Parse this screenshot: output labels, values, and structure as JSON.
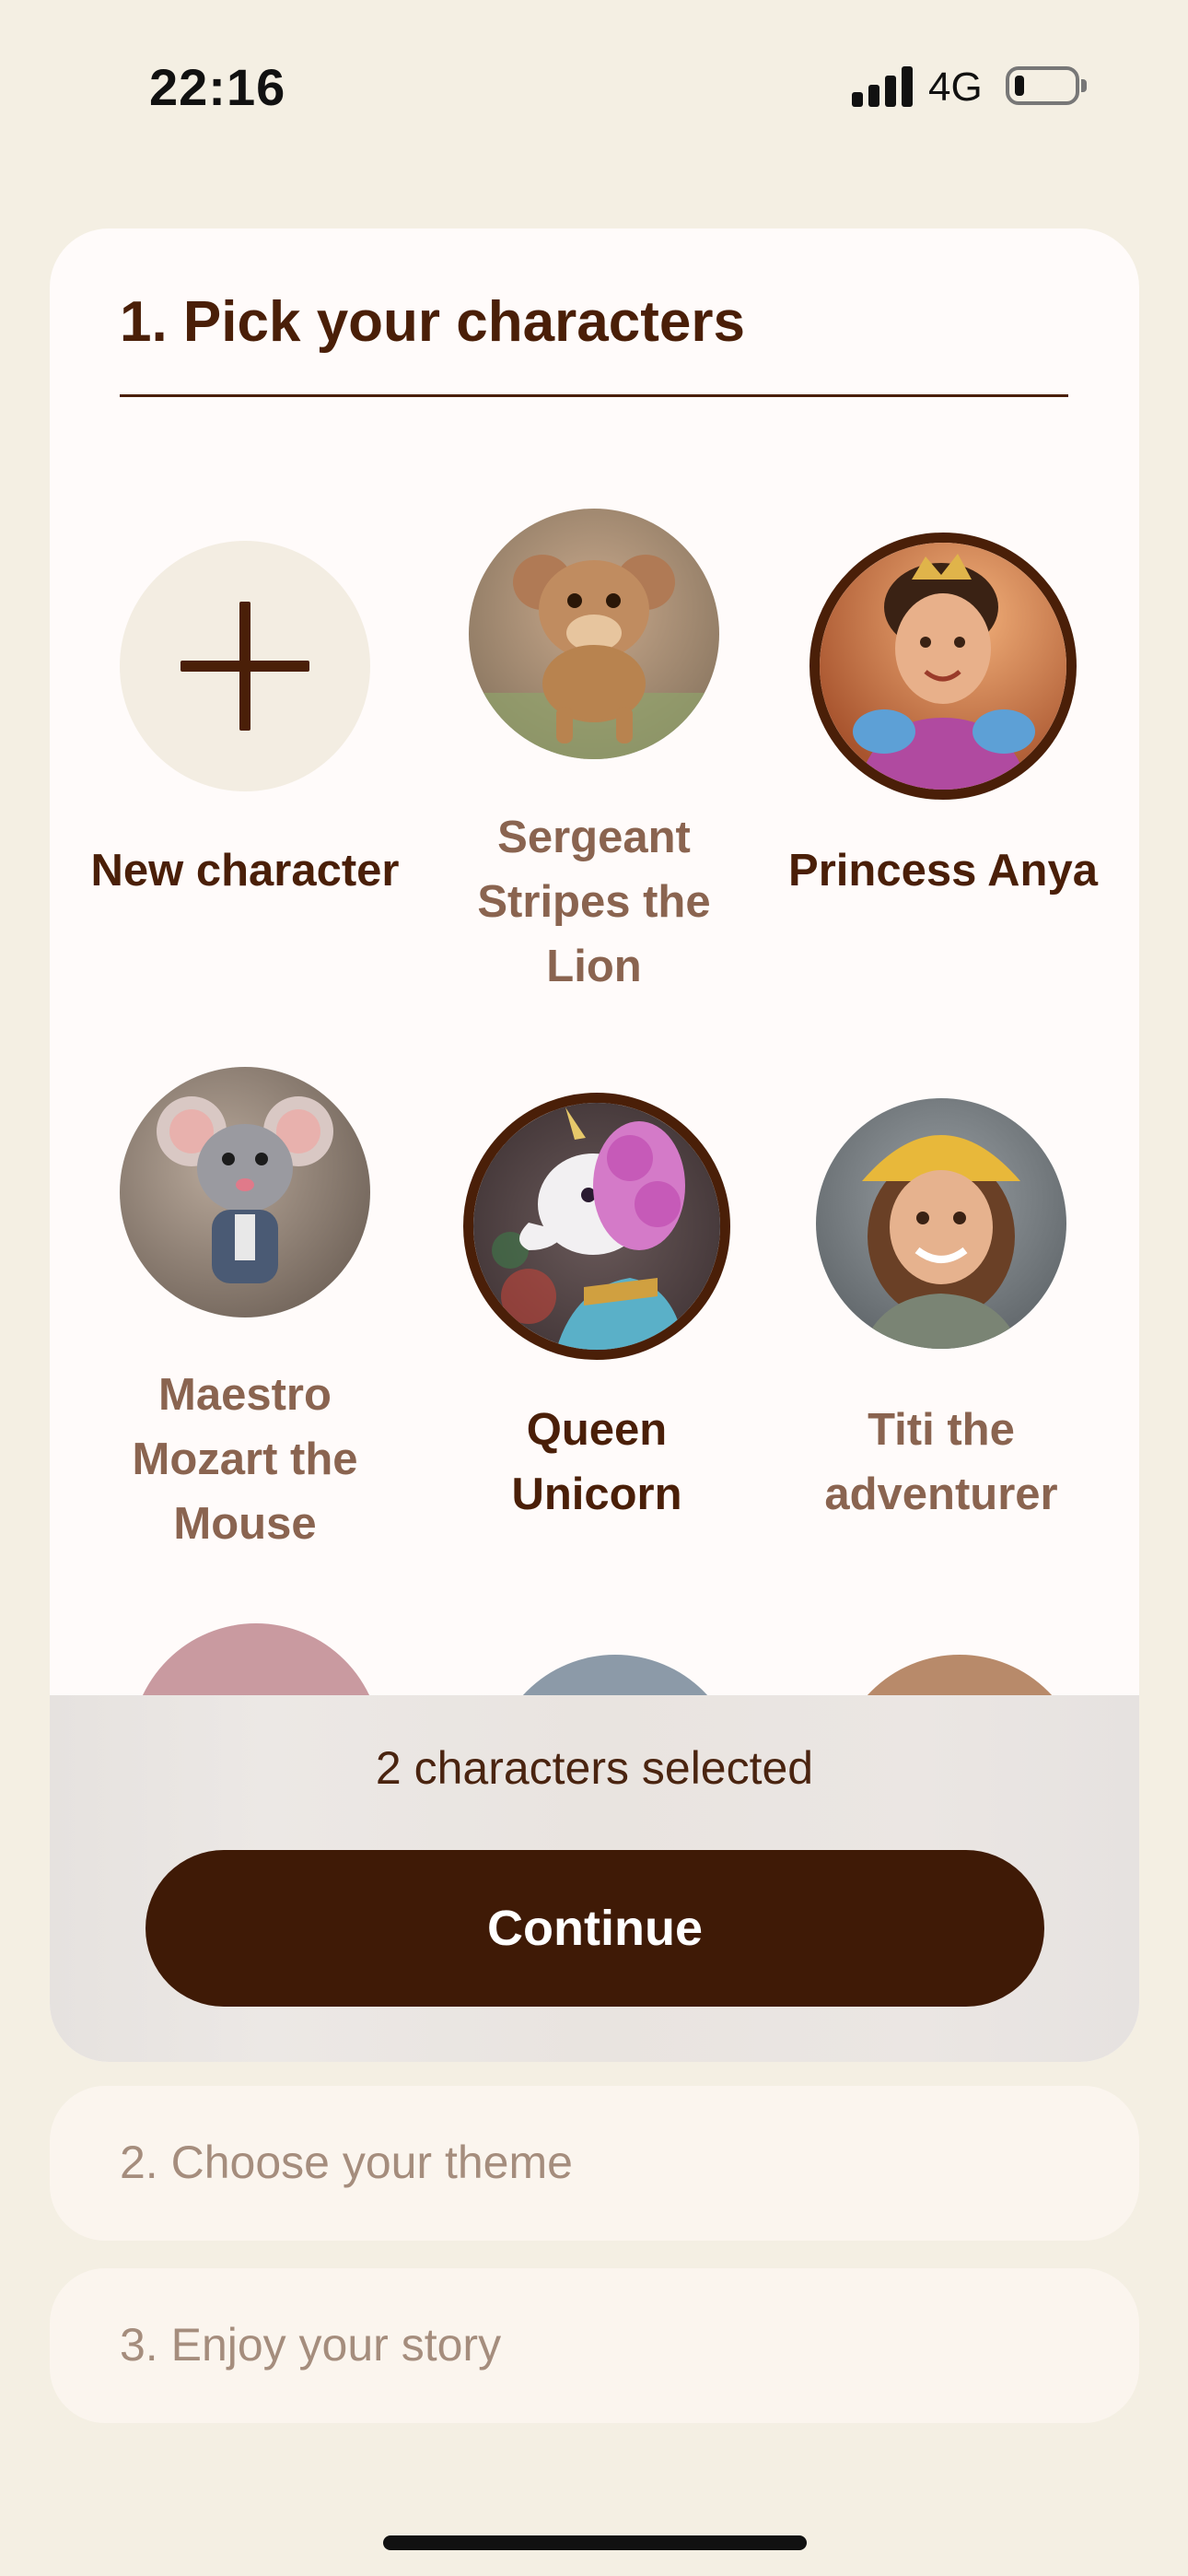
{
  "status_bar": {
    "time": "22:16",
    "network": "4G",
    "battery_level": 0.15
  },
  "picker": {
    "title": "1. Pick your characters",
    "new_character_label": "New character",
    "characters": [
      {
        "name": "Sergeant Stripes the Lion",
        "selected": false
      },
      {
        "name": "Princess Anya",
        "selected": true
      },
      {
        "name": "Maestro Mozart the Mouse",
        "selected": false
      },
      {
        "name": "Queen Unicorn",
        "selected": true
      },
      {
        "name": "Titi the adventurer",
        "selected": false
      }
    ],
    "selected_count_text": "2 characters selected",
    "continue_label": "Continue"
  },
  "steps": [
    {
      "label": "2. Choose your theme"
    },
    {
      "label": "3. Enjoy your story"
    }
  ],
  "colors": {
    "background": "#f4efe3",
    "card": "#fffbfa",
    "accent": "#3f1a06",
    "muted_text": "#8a6450"
  }
}
